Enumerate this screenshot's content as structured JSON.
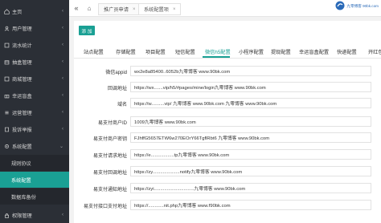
{
  "sidebar": {
    "items": [
      {
        "label": "主页",
        "icon": "home-icon",
        "chevron": "‹"
      },
      {
        "label": "用户管理",
        "icon": "user-icon",
        "chevron": "‹"
      },
      {
        "label": "流水统计",
        "icon": "chart-icon",
        "chevron": "‹"
      },
      {
        "label": "抽盒管理",
        "icon": "box-icon",
        "chevron": "‹"
      },
      {
        "label": "商城管理",
        "icon": "shop-icon",
        "chevron": "‹"
      },
      {
        "label": "幸运盲盒",
        "icon": "gift-icon",
        "chevron": "‹"
      },
      {
        "label": "运营管理",
        "icon": "ops-icon",
        "chevron": "‹"
      },
      {
        "label": "投诉举报",
        "icon": "report-icon",
        "chevron": "‹"
      },
      {
        "label": "系统配置",
        "icon": "gear-icon",
        "chevron": "⌄"
      }
    ],
    "sub_items": [
      {
        "label": "规则协议"
      },
      {
        "label": "系统配置"
      },
      {
        "label": "数据库备份"
      }
    ],
    "bottom_item": {
      "label": "权限管理",
      "icon": "lock-icon",
      "chevron": "‹"
    }
  },
  "topbar": {
    "collapse_icon": "«",
    "home_icon": "⌂",
    "tabs": [
      {
        "label": "推广员申请",
        "close": "×"
      },
      {
        "label": "系统配置项",
        "close": "×"
      }
    ],
    "logo_text": "九零博客 90bk.com"
  },
  "content": {
    "add_button": "添 加",
    "tabs": [
      "站点配置",
      "存储配置",
      "项目配置",
      "短信配置",
      "微信h5配置",
      "小程序配置",
      "提现配置",
      "幸运盲盒配置",
      "快递配置",
      "开红包"
    ],
    "active_tab_index": 4,
    "fields": [
      {
        "label": "微信appid",
        "value": "wx2e8a85400..6052b九零博客 www.90bk.com"
      },
      {
        "label": "回调地址",
        "value": "https://wx.......vip/h5/#pages/mine/login九零博客 www.90bk.com"
      },
      {
        "label": "域名",
        "value": "https://w..........vip/ 九零博客 www.90bk.com  九零博客 www.90bk.com"
      },
      {
        "label": "易支付商户ID",
        "value": "1009九零博客 www.90bk.com"
      },
      {
        "label": "易支付商户密钥",
        "value": "FJhffG5657ETW6w270EOrY66TgflRbt6 九零博客 www.90bk.com"
      },
      {
        "label": "易支付请求地址",
        "value": "https://e..................tp九零博客 www.90bk.com"
      },
      {
        "label": "易支付回调地址",
        "value": "https://zy.....................notify九零博客 www.90bk.com"
      },
      {
        "label": "易支付通知地址",
        "value": "https://zyi...............................九零博客 www.90bk.com"
      },
      {
        "label": "易支付接口支付地址",
        "value": "https://............nit.php九零博客 www.f90bk.com"
      }
    ]
  },
  "colors": {
    "accent": "#1aa094",
    "sidebar_bg": "#2b2f36"
  }
}
